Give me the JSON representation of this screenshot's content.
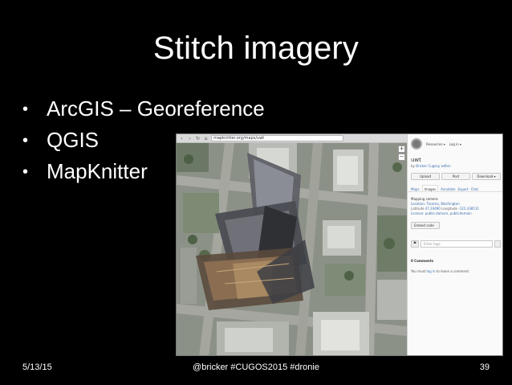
{
  "slide": {
    "title": "Stitch imagery",
    "bullets": [
      "ArcGIS – Georeference",
      "QGIS",
      "MapKnitter"
    ],
    "footer": {
      "date": "5/13/15",
      "center": "@bricker #CUGOS2015 #dronie",
      "page": "39"
    }
  },
  "screenshot": {
    "browser": {
      "url": "mapknitter.org/maps/uwt"
    },
    "map": {
      "zoom_in": "+",
      "zoom_out": "−"
    },
    "panel": {
      "menu_resources": "Resources ▾",
      "menu_login": "Log in ▾",
      "map_title": "uwt",
      "author_prefix": "by",
      "author": "Bricker Cugosy within",
      "actions": [
        "Upload",
        "Post",
        "Download ▾"
      ],
      "tabs": [
        "Maps",
        "Images",
        "Annotate",
        "Export",
        "Chat"
      ],
      "info": {
        "heading": "Mapping camera",
        "location": "Location: Tacoma, Washington",
        "lat_label": "Latitude",
        "lat": "47.24490",
        "lon_label": "Longitude",
        "lon": "-122.438511",
        "license": "License: public-domain, publicdomain"
      },
      "embed_label": "Embed code",
      "tags_placeholder": "Enter tags",
      "comments_heading": "0 Comments",
      "comments_note_prefix": "You must",
      "comments_note_link": "log in",
      "comments_note_suffix": "to leave a comment."
    }
  }
}
